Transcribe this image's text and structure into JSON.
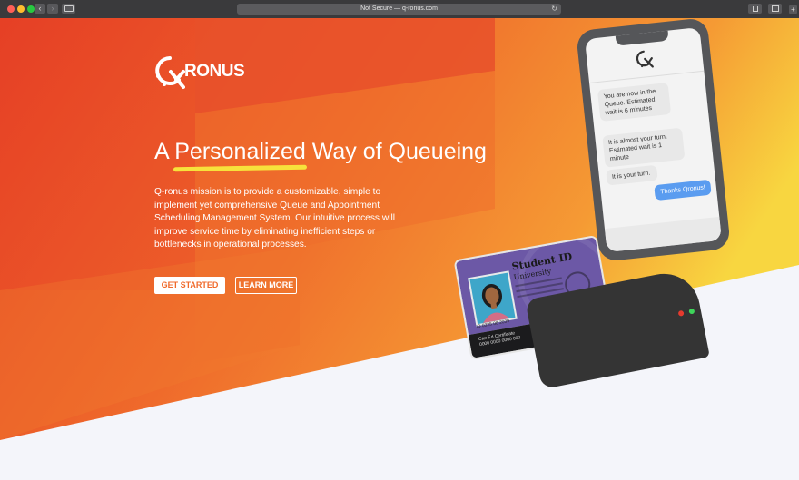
{
  "browser": {
    "address": "Not Secure — q-ronus.com",
    "back_icon": "‹",
    "forward_icon": "›",
    "reload_icon": "↻",
    "new_tab_icon": "+"
  },
  "brand": {
    "logo_text": "RONUS",
    "colors": {
      "orange": "#f06a2b",
      "deep_orange": "#e0412a",
      "yellow": "#f7d93b",
      "white": "#ffffff"
    }
  },
  "hero": {
    "headline_pre": "A ",
    "headline_highlight": "Personalized",
    "headline_post": " Way of Queueing",
    "description": "Q-ronus mission is to provide a customizable, simple to implement yet comprehensive Queue and Appointment Scheduling Management System. Our intuitive process will improve service time by eliminating inefficient steps or bottlenecks in operational processes.",
    "primary_button": "GET STARTED",
    "secondary_button": "LEARN MORE"
  },
  "phone": {
    "messages": [
      "You are now in the Queue. Estimated wait is 6 minutes",
      "It is almost your turn! Estimated wait is 1 minute",
      "It is your turn.",
      "Thanks Qronus!"
    ]
  },
  "card": {
    "title": "Student ID",
    "subtitle": "University",
    "number": "ID 0325 08 2039",
    "footer_line1": "Can Ed Certificate",
    "footer_line2": "0000 0000 0000 000"
  }
}
